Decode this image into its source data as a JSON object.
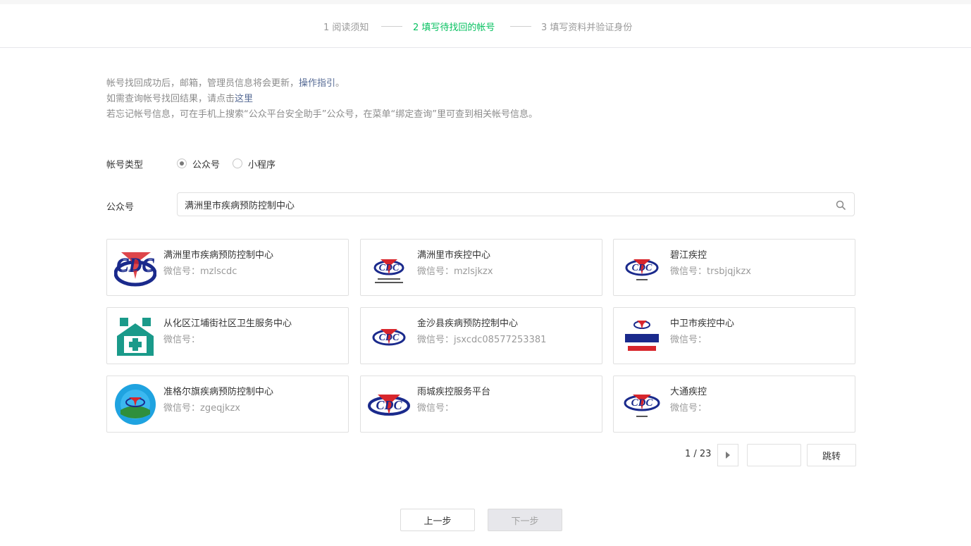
{
  "steps": [
    {
      "label": "1 阅读须知"
    },
    {
      "label": "2 填写待找回的帐号"
    },
    {
      "label": "3 填写资料并验证身份"
    }
  ],
  "notice": {
    "line1_text": "帐号找回成功后，邮箱，管理员信息将会更新，",
    "line1_link": "操作指引",
    "line1_end": "。",
    "line2_text": "如需查询帐号找回结果，请点击",
    "line2_link": "这里",
    "line3_text": "若忘记帐号信息，可在手机上搜索“公众平台安全助手”公众号，在菜单“绑定查询”里可查到相关帐号信息。"
  },
  "account_type": {
    "label": "帐号类型",
    "options": [
      "公众号",
      "小程序"
    ],
    "selected": "公众号"
  },
  "search": {
    "label": "公众号",
    "value": "满洲里市疾病预防控制中心"
  },
  "results": [
    {
      "name": "满洲里市疾病预防控制中心",
      "wechat_id": "微信号：mzlscdc",
      "logo": "cdc-logo-large"
    },
    {
      "name": "满洲里市疾控中心",
      "wechat_id": "微信号：mzlsjkzx",
      "logo": "cdc-logo-small"
    },
    {
      "name": "碧江疾控",
      "wechat_id": "微信号：trsbjqjkzx",
      "logo": "cdc-logo-small"
    },
    {
      "name": "从化区江埔街社区卫生服务中心",
      "wechat_id": "微信号：",
      "logo": "health-house-icon"
    },
    {
      "name": "金沙县疾病预防控制中心",
      "wechat_id": "微信号：jsxcdc08577253381",
      "logo": "cdc-logo-small"
    },
    {
      "name": "中卫市疾控中心",
      "wechat_id": "微信号：",
      "logo": "health-cert-logo"
    },
    {
      "name": "准格尔旗疾病预防控制中心",
      "wechat_id": "微信号：zgeqjkzx",
      "logo": "circle-badge-logo"
    },
    {
      "name": "雨城疾控服务平台",
      "wechat_id": "微信号：",
      "logo": "cdc-logo-wide"
    },
    {
      "name": "大通疾控",
      "wechat_id": "微信号：",
      "logo": "cdc-logo-small"
    }
  ],
  "pagination": {
    "text": "1 / 23",
    "jump_label": "跳转",
    "jump_value": ""
  },
  "buttons": {
    "prev": "上一步",
    "next": "下一步"
  },
  "colors": {
    "accent": "#07c160",
    "link": "#576b95",
    "logo_red": "#d8262c",
    "logo_blue": "#1a2a8c",
    "logo_teal": "#1a9a8a"
  }
}
